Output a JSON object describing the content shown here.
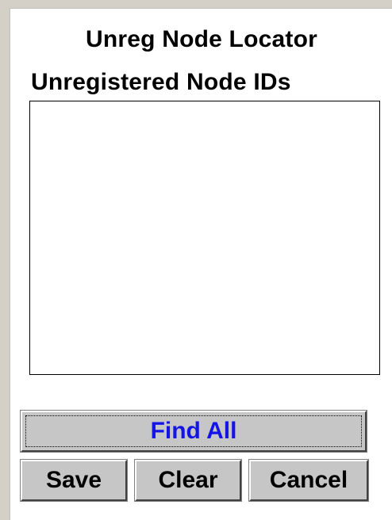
{
  "dialog": {
    "title": "Unreg Node Locator",
    "list_label": "Unregistered Node IDs",
    "node_ids": []
  },
  "buttons": {
    "find_all": "Find All",
    "save": "Save",
    "clear": "Clear",
    "cancel": "Cancel"
  },
  "colors": {
    "window_background": "#d4d0c8",
    "panel_background": "#ffffff",
    "button_face": "#c6c6c6",
    "find_all_text": "#1414e6"
  }
}
